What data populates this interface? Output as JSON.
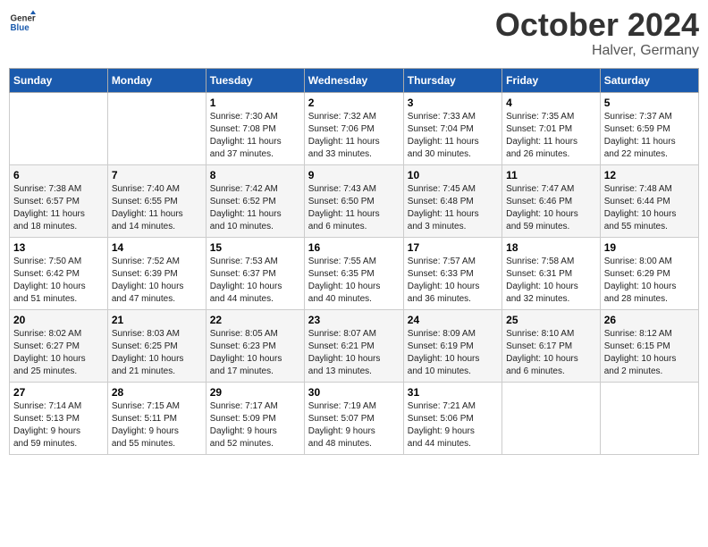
{
  "header": {
    "logo": {
      "general": "General",
      "blue": "Blue"
    },
    "title": "October 2024",
    "location": "Halver, Germany"
  },
  "calendar": {
    "days_of_week": [
      "Sunday",
      "Monday",
      "Tuesday",
      "Wednesday",
      "Thursday",
      "Friday",
      "Saturday"
    ],
    "weeks": [
      [
        {
          "day": "",
          "info": ""
        },
        {
          "day": "",
          "info": ""
        },
        {
          "day": "1",
          "info": "Sunrise: 7:30 AM\nSunset: 7:08 PM\nDaylight: 11 hours\nand 37 minutes."
        },
        {
          "day": "2",
          "info": "Sunrise: 7:32 AM\nSunset: 7:06 PM\nDaylight: 11 hours\nand 33 minutes."
        },
        {
          "day": "3",
          "info": "Sunrise: 7:33 AM\nSunset: 7:04 PM\nDaylight: 11 hours\nand 30 minutes."
        },
        {
          "day": "4",
          "info": "Sunrise: 7:35 AM\nSunset: 7:01 PM\nDaylight: 11 hours\nand 26 minutes."
        },
        {
          "day": "5",
          "info": "Sunrise: 7:37 AM\nSunset: 6:59 PM\nDaylight: 11 hours\nand 22 minutes."
        }
      ],
      [
        {
          "day": "6",
          "info": "Sunrise: 7:38 AM\nSunset: 6:57 PM\nDaylight: 11 hours\nand 18 minutes."
        },
        {
          "day": "7",
          "info": "Sunrise: 7:40 AM\nSunset: 6:55 PM\nDaylight: 11 hours\nand 14 minutes."
        },
        {
          "day": "8",
          "info": "Sunrise: 7:42 AM\nSunset: 6:52 PM\nDaylight: 11 hours\nand 10 minutes."
        },
        {
          "day": "9",
          "info": "Sunrise: 7:43 AM\nSunset: 6:50 PM\nDaylight: 11 hours\nand 6 minutes."
        },
        {
          "day": "10",
          "info": "Sunrise: 7:45 AM\nSunset: 6:48 PM\nDaylight: 11 hours\nand 3 minutes."
        },
        {
          "day": "11",
          "info": "Sunrise: 7:47 AM\nSunset: 6:46 PM\nDaylight: 10 hours\nand 59 minutes."
        },
        {
          "day": "12",
          "info": "Sunrise: 7:48 AM\nSunset: 6:44 PM\nDaylight: 10 hours\nand 55 minutes."
        }
      ],
      [
        {
          "day": "13",
          "info": "Sunrise: 7:50 AM\nSunset: 6:42 PM\nDaylight: 10 hours\nand 51 minutes."
        },
        {
          "day": "14",
          "info": "Sunrise: 7:52 AM\nSunset: 6:39 PM\nDaylight: 10 hours\nand 47 minutes."
        },
        {
          "day": "15",
          "info": "Sunrise: 7:53 AM\nSunset: 6:37 PM\nDaylight: 10 hours\nand 44 minutes."
        },
        {
          "day": "16",
          "info": "Sunrise: 7:55 AM\nSunset: 6:35 PM\nDaylight: 10 hours\nand 40 minutes."
        },
        {
          "day": "17",
          "info": "Sunrise: 7:57 AM\nSunset: 6:33 PM\nDaylight: 10 hours\nand 36 minutes."
        },
        {
          "day": "18",
          "info": "Sunrise: 7:58 AM\nSunset: 6:31 PM\nDaylight: 10 hours\nand 32 minutes."
        },
        {
          "day": "19",
          "info": "Sunrise: 8:00 AM\nSunset: 6:29 PM\nDaylight: 10 hours\nand 28 minutes."
        }
      ],
      [
        {
          "day": "20",
          "info": "Sunrise: 8:02 AM\nSunset: 6:27 PM\nDaylight: 10 hours\nand 25 minutes."
        },
        {
          "day": "21",
          "info": "Sunrise: 8:03 AM\nSunset: 6:25 PM\nDaylight: 10 hours\nand 21 minutes."
        },
        {
          "day": "22",
          "info": "Sunrise: 8:05 AM\nSunset: 6:23 PM\nDaylight: 10 hours\nand 17 minutes."
        },
        {
          "day": "23",
          "info": "Sunrise: 8:07 AM\nSunset: 6:21 PM\nDaylight: 10 hours\nand 13 minutes."
        },
        {
          "day": "24",
          "info": "Sunrise: 8:09 AM\nSunset: 6:19 PM\nDaylight: 10 hours\nand 10 minutes."
        },
        {
          "day": "25",
          "info": "Sunrise: 8:10 AM\nSunset: 6:17 PM\nDaylight: 10 hours\nand 6 minutes."
        },
        {
          "day": "26",
          "info": "Sunrise: 8:12 AM\nSunset: 6:15 PM\nDaylight: 10 hours\nand 2 minutes."
        }
      ],
      [
        {
          "day": "27",
          "info": "Sunrise: 7:14 AM\nSunset: 5:13 PM\nDaylight: 9 hours\nand 59 minutes."
        },
        {
          "day": "28",
          "info": "Sunrise: 7:15 AM\nSunset: 5:11 PM\nDaylight: 9 hours\nand 55 minutes."
        },
        {
          "day": "29",
          "info": "Sunrise: 7:17 AM\nSunset: 5:09 PM\nDaylight: 9 hours\nand 52 minutes."
        },
        {
          "day": "30",
          "info": "Sunrise: 7:19 AM\nSunset: 5:07 PM\nDaylight: 9 hours\nand 48 minutes."
        },
        {
          "day": "31",
          "info": "Sunrise: 7:21 AM\nSunset: 5:06 PM\nDaylight: 9 hours\nand 44 minutes."
        },
        {
          "day": "",
          "info": ""
        },
        {
          "day": "",
          "info": ""
        }
      ]
    ]
  }
}
